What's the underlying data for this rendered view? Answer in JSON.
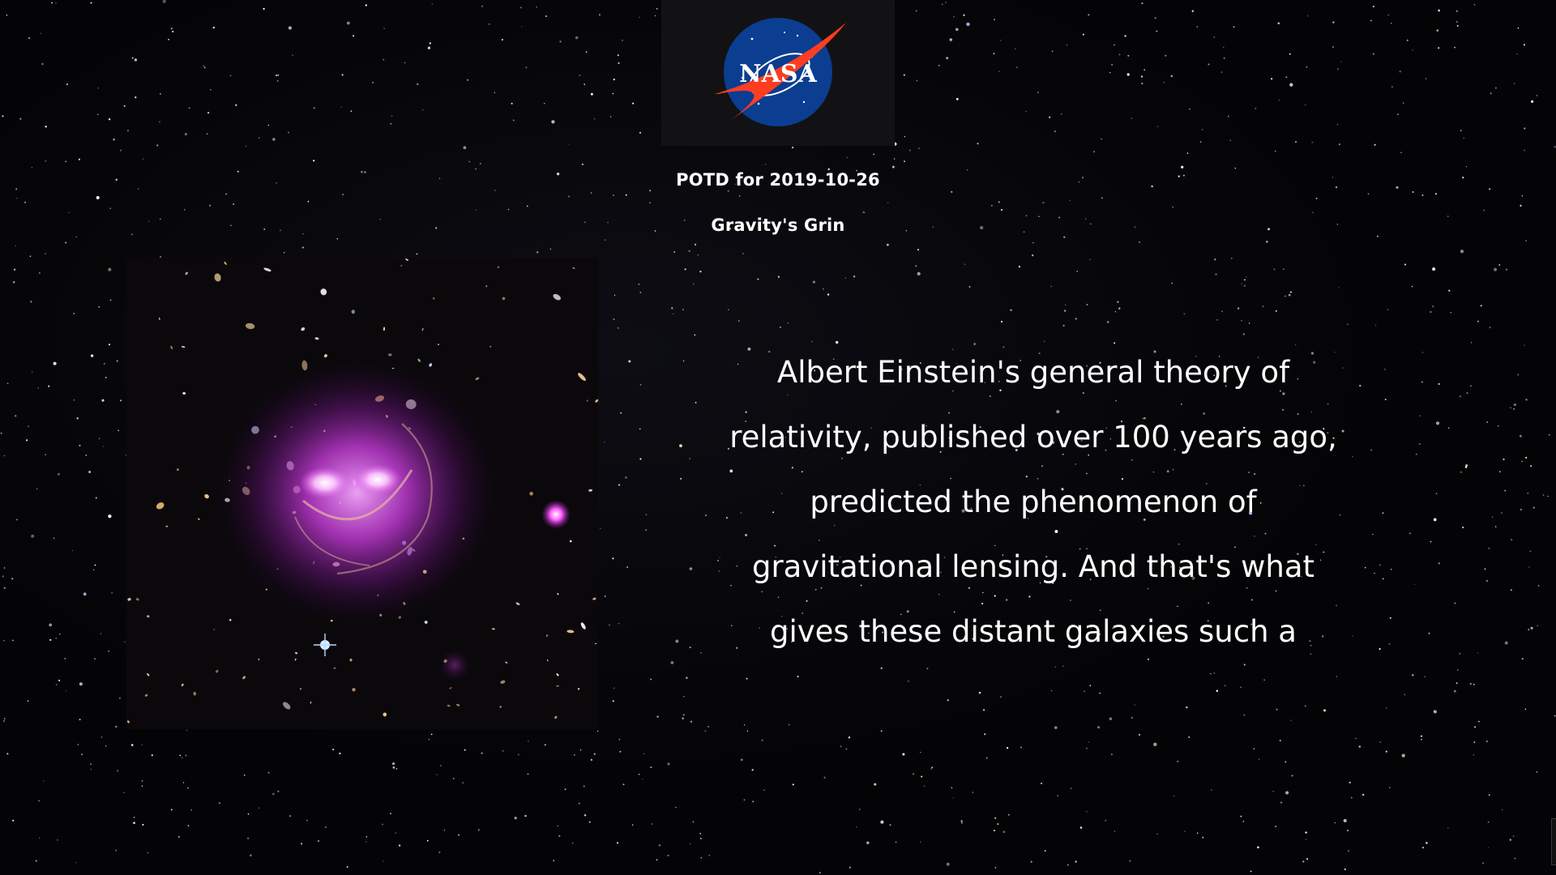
{
  "logo": {
    "text": "NASA",
    "icon": "nasa-meatball-logo",
    "colors": {
      "blue": "#0b3d91",
      "red": "#fc3d21",
      "white": "#ffffff"
    }
  },
  "potd": {
    "date_label": "POTD for 2019-10-26",
    "title": "Gravity's Grin",
    "explanation": "Albert Einstein's general theory of relativity, published over 100 years ago, predicted the phenomenon of gravitational lensing. And that's what gives these distant galaxies such a"
  },
  "image": {
    "icon": "galaxy-cluster-image",
    "accent": "#e040f0"
  },
  "background": {
    "icon": "starfield-background",
    "color": "#040406"
  }
}
